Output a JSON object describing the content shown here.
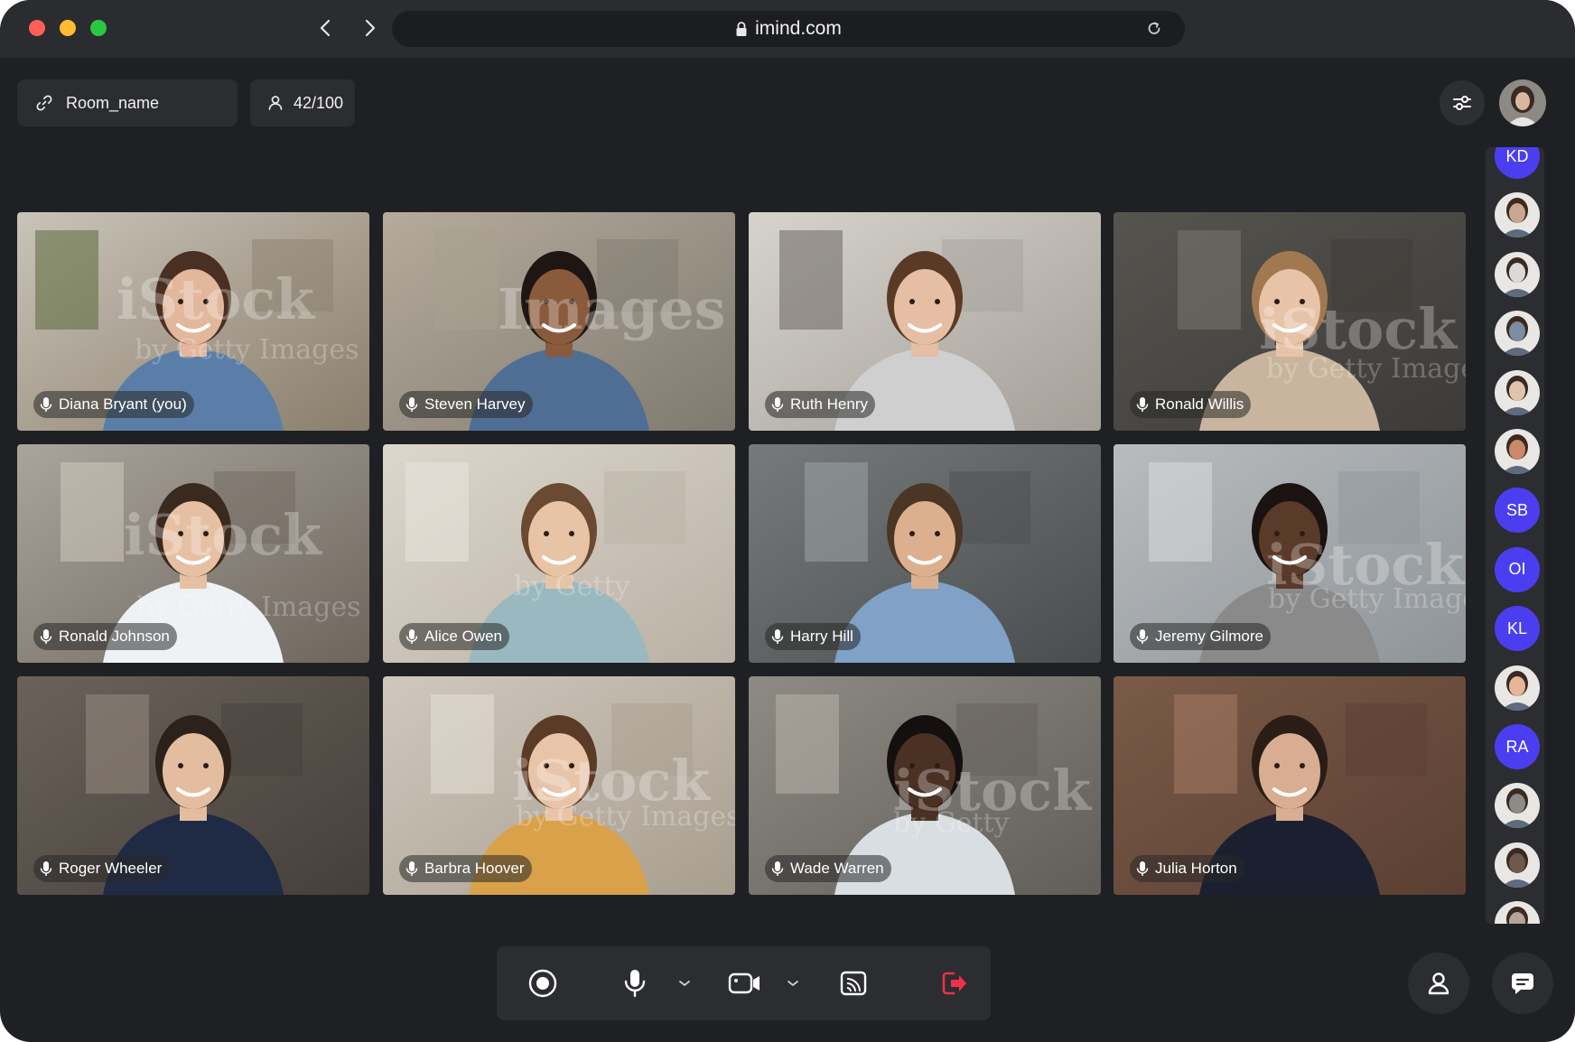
{
  "browser": {
    "url": "imind.com"
  },
  "room": {
    "name": "Room_name",
    "participants_count": "42/100"
  },
  "tiles": [
    {
      "name": "Diana Bryant (you)",
      "watermark": "iStock",
      "watermark_sub": "by Getty Images"
    },
    {
      "name": "Steven Harvey",
      "watermark": "Images",
      "watermark_sub": ""
    },
    {
      "name": "Ruth Henry",
      "watermark": "",
      "watermark_sub": ""
    },
    {
      "name": "Ronald Willis",
      "watermark": "iStock",
      "watermark_sub": "by Getty Images"
    },
    {
      "name": "Ronald Johnson",
      "watermark": "iStock",
      "watermark_sub": "by Getty Images"
    },
    {
      "name": "Alice Owen",
      "watermark": "",
      "watermark_sub": "by Getty"
    },
    {
      "name": "Harry Hill",
      "watermark": "",
      "watermark_sub": ""
    },
    {
      "name": "Jeremy Gilmore",
      "watermark": "iStock",
      "watermark_sub": "by Getty Images"
    },
    {
      "name": "Roger Wheeler",
      "watermark": "",
      "watermark_sub": ""
    },
    {
      "name": "Barbra Hoover",
      "watermark": "iStock",
      "watermark_sub": "by Getty Images"
    },
    {
      "name": "Wade Warren",
      "watermark": "iStock",
      "watermark_sub": "by Getty"
    },
    {
      "name": "Julia Horton",
      "watermark": "",
      "watermark_sub": ""
    }
  ],
  "rail": [
    {
      "type": "initials",
      "text": "KD"
    },
    {
      "type": "photo",
      "text": ""
    },
    {
      "type": "photo",
      "text": ""
    },
    {
      "type": "photo",
      "text": ""
    },
    {
      "type": "photo",
      "text": ""
    },
    {
      "type": "photo",
      "text": ""
    },
    {
      "type": "initials",
      "text": "SB"
    },
    {
      "type": "initials",
      "text": "OI"
    },
    {
      "type": "initials",
      "text": "KL"
    },
    {
      "type": "photo",
      "text": ""
    },
    {
      "type": "initials",
      "text": "RA"
    },
    {
      "type": "photo",
      "text": ""
    },
    {
      "type": "photo",
      "text": ""
    },
    {
      "type": "photo",
      "text": ""
    }
  ],
  "colors": {
    "background": "#1f2023",
    "panel": "#2c2d31",
    "accent": "#4b3ef0",
    "leave": "#f0304a"
  }
}
